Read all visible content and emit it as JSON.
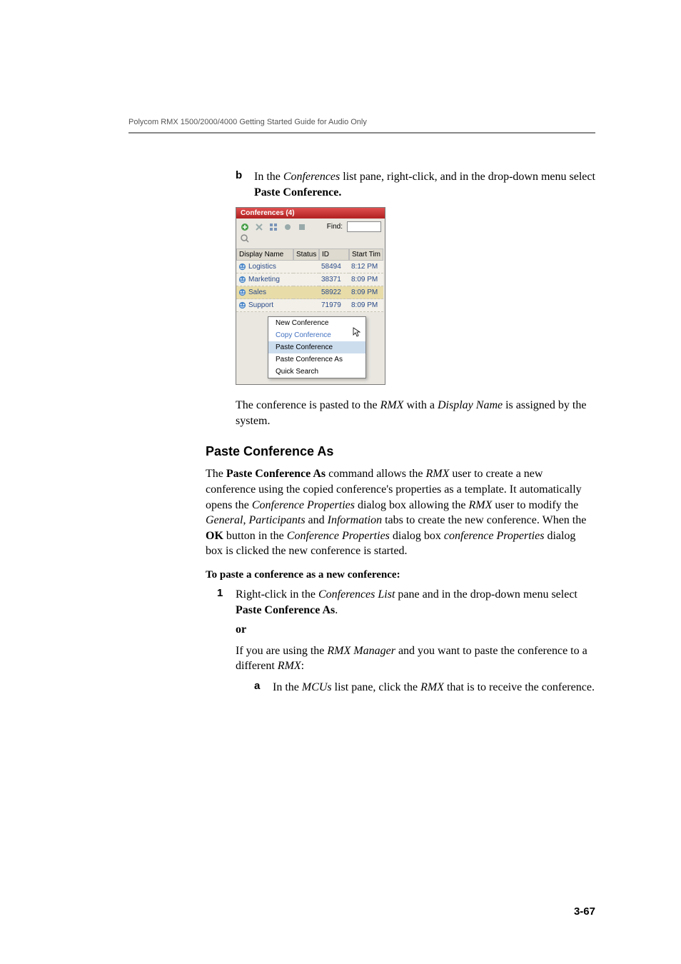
{
  "header": {
    "running": "Polycom RMX 1500/2000/4000 Getting Started Guide for Audio Only"
  },
  "stepB": {
    "letter": "b",
    "text_pre": "In the ",
    "text_italic1": "Conferences",
    "text_mid": " list pane, right-click, and in the drop-down menu select ",
    "text_bold": "Paste Conference."
  },
  "shot": {
    "title": "Conferences (4)",
    "find_label": "Find:",
    "columns": {
      "name": "Display Name",
      "status": "Status",
      "id": "ID",
      "time": "Start Tim"
    },
    "rows": [
      {
        "name": "Logistics",
        "id": "58494",
        "time": "8:12 PM"
      },
      {
        "name": "Marketing",
        "id": "38371",
        "time": "8:09 PM"
      },
      {
        "name": "Sales",
        "id": "58922",
        "time": "8:09 PM",
        "selected": true
      },
      {
        "name": "Support",
        "id": "71979",
        "time": "8:09 PM"
      }
    ],
    "menu": {
      "new": "New Conference",
      "copy": "Copy Conference",
      "paste": "Paste Conference",
      "paste_as": "Paste Conference As",
      "quick": "Quick Search"
    }
  },
  "afterShot": {
    "pre": "The conference is pasted to the ",
    "italic1": "RMX",
    "mid": " with a ",
    "italic2": "Display Name",
    "post": " is assigned by the system."
  },
  "section": {
    "title": "Paste Conference As"
  },
  "desc": {
    "t1": "The ",
    "b1": "Paste Conference As",
    "t2": " command allows the ",
    "i1": "RMX",
    "t3": " user to create a new conference using the copied conference's properties as a template. It automatically opens the ",
    "i2": "Conference Properties",
    "t4": " dialog box allowing the ",
    "i3": "RMX",
    "t5": " user to modify the ",
    "i4": "General",
    "t6": ", ",
    "i5": "Participants",
    "t7": " and ",
    "i6": "Information",
    "t8": " tabs to create the new conference. When the ",
    "b2": "OK",
    "t9": " button in the ",
    "i7": "Conference Properties",
    "t10": " dialog box ",
    "i8": "conference Properties",
    "t11": " dialog box is clicked the new conference is started."
  },
  "proc": {
    "title": "To paste a conference as a new conference:"
  },
  "step1": {
    "num": "1",
    "pre": "Right-click in the ",
    "italic": "Conferences List",
    "mid": " pane and in the drop-down menu select",
    "bold": "Paste Conference As",
    "dot": ".",
    "or": "or",
    "if_pre": "If you are using the ",
    "if_i1": "RMX Manager",
    "if_mid": " and you want to paste the conference to a different ",
    "if_i2": "RMX",
    "if_post": ":"
  },
  "stepA": {
    "letter": "a",
    "pre": "In the ",
    "i1": "MCUs",
    "mid": " list pane, click the ",
    "i2": "RMX",
    "post": " that is to receive the conference."
  },
  "footer": {
    "page": "3-67"
  }
}
